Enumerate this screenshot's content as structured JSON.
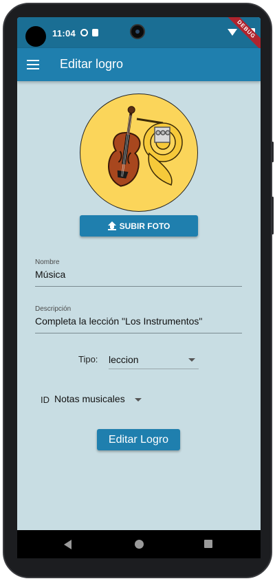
{
  "status_bar": {
    "time": "11:04",
    "debug_label": "DEBUG"
  },
  "app_bar": {
    "title": "Editar logro"
  },
  "upload_button": {
    "label": "SUBIR FOTO"
  },
  "form": {
    "name": {
      "label": "Nombre",
      "value": "Música"
    },
    "description": {
      "label": "Descripción",
      "value": "Completa la lección \"Los Instrumentos\""
    },
    "type": {
      "label": "Tipo:",
      "value": "leccion"
    },
    "id": {
      "label": "ID",
      "value": "Notas musicales"
    }
  },
  "submit_button": {
    "label": "Editar Logro"
  },
  "colors": {
    "primary": "#1f7fae",
    "status_bar": "#1a6e94",
    "background": "#c8dde3",
    "avatar_bg": "#fbd55a"
  }
}
